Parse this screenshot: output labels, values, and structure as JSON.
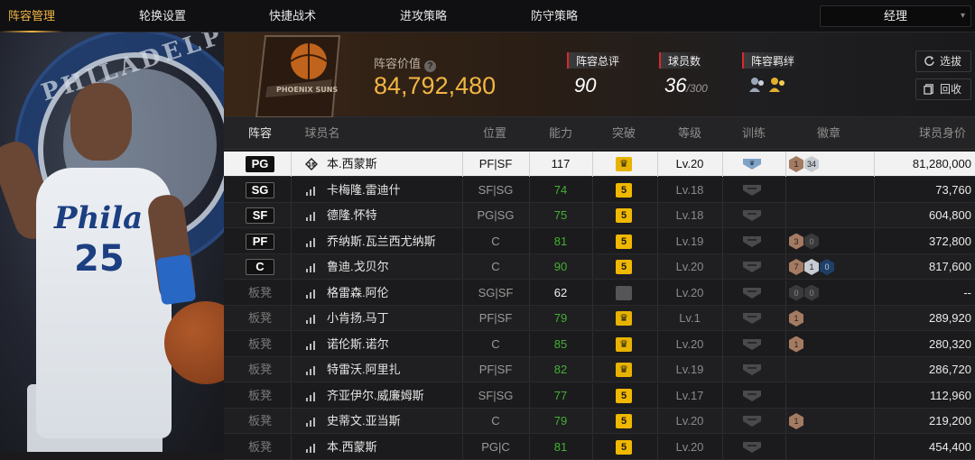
{
  "nav": {
    "tabs": [
      {
        "label": "阵容管理",
        "active": true
      },
      {
        "label": "轮换设置",
        "active": false
      },
      {
        "label": "快捷战术",
        "active": false
      },
      {
        "label": "进攻策略",
        "active": false
      },
      {
        "label": "防守策略",
        "active": false
      }
    ],
    "role_select": "经理"
  },
  "player_art": {
    "team_wordmark": "PHILADELPHIA",
    "jersey_text": "Phila",
    "jersey_number": "25"
  },
  "header": {
    "team_logo_text": "PHOENIX SUNS",
    "value_label": "阵容价值",
    "value": "84,792,480",
    "stats": [
      {
        "label": "阵容总评",
        "value": "90",
        "sub": ""
      },
      {
        "label": "球员数",
        "value": "36",
        "sub": "/300"
      },
      {
        "label": "阵容羁绊",
        "value": "",
        "sub": ""
      }
    ],
    "buttons": {
      "select": "选拔",
      "recall": "回收"
    }
  },
  "table": {
    "columns": [
      "阵容",
      "球员名",
      "位置",
      "能力",
      "突破",
      "等级",
      "训练",
      "徽章",
      "球员身价"
    ],
    "rows": [
      {
        "slot": "PG",
        "starter": true,
        "selected": true,
        "name": "本.西蒙斯",
        "pos": "PF|SF",
        "rating": "117",
        "rating_color": "white",
        "break": "crown",
        "level": "Lv.20",
        "train": "active",
        "badges": [
          {
            "t": "bronze",
            "n": "1"
          },
          {
            "t": "silver",
            "n": "34"
          }
        ],
        "value": "81,280,000"
      },
      {
        "slot": "SG",
        "starter": true,
        "selected": false,
        "name": "卡梅隆.雷迪什",
        "pos": "SF|SG",
        "rating": "74",
        "rating_color": "green",
        "break": "5",
        "level": "Lv.18",
        "train": "idle",
        "badges": [],
        "value": "73,760"
      },
      {
        "slot": "SF",
        "starter": true,
        "selected": false,
        "name": "德隆.怀特",
        "pos": "PG|SG",
        "rating": "75",
        "rating_color": "green",
        "break": "5",
        "level": "Lv.18",
        "train": "idle",
        "badges": [],
        "value": "604,800"
      },
      {
        "slot": "PF",
        "starter": true,
        "selected": false,
        "name": "乔纳斯.瓦兰西尤纳斯",
        "pos": "C",
        "rating": "81",
        "rating_color": "green",
        "break": "5",
        "level": "Lv.19",
        "train": "idle",
        "badges": [
          {
            "t": "bronze",
            "n": "3"
          },
          {
            "t": "dark",
            "n": "0"
          }
        ],
        "value": "372,800"
      },
      {
        "slot": "C",
        "starter": true,
        "selected": false,
        "name": "鲁迪.戈贝尔",
        "pos": "C",
        "rating": "90",
        "rating_color": "green",
        "break": "5",
        "level": "Lv.20",
        "train": "idle",
        "badges": [
          {
            "t": "bronze",
            "n": "7"
          },
          {
            "t": "silver",
            "n": "1"
          },
          {
            "t": "blue",
            "n": "0"
          }
        ],
        "value": "817,600"
      },
      {
        "slot": "板凳",
        "starter": false,
        "selected": false,
        "name": "格雷森.阿伦",
        "pos": "SG|SF",
        "rating": "62",
        "rating_color": "white",
        "break": "gray",
        "level": "Lv.20",
        "train": "idle",
        "badges": [
          {
            "t": "dark",
            "n": "0"
          },
          {
            "t": "dark",
            "n": "0"
          }
        ],
        "value": "--"
      },
      {
        "slot": "板凳",
        "starter": false,
        "selected": false,
        "name": "小肯扬.马丁",
        "pos": "PF|SF",
        "rating": "79",
        "rating_color": "green",
        "break": "crown",
        "level": "Lv.1",
        "train": "idle",
        "badges": [
          {
            "t": "bronze",
            "n": "1"
          }
        ],
        "value": "289,920"
      },
      {
        "slot": "板凳",
        "starter": false,
        "selected": false,
        "name": "诺伦斯.诺尔",
        "pos": "C",
        "rating": "85",
        "rating_color": "green",
        "break": "crown",
        "level": "Lv.20",
        "train": "idle",
        "badges": [
          {
            "t": "bronze",
            "n": "1"
          }
        ],
        "value": "280,320"
      },
      {
        "slot": "板凳",
        "starter": false,
        "selected": false,
        "name": "特雷沃.阿里扎",
        "pos": "PF|SF",
        "rating": "82",
        "rating_color": "green",
        "break": "crown",
        "level": "Lv.19",
        "train": "idle",
        "badges": [],
        "value": "286,720"
      },
      {
        "slot": "板凳",
        "starter": false,
        "selected": false,
        "name": "齐亚伊尔.威廉姆斯",
        "pos": "SF|SG",
        "rating": "77",
        "rating_color": "green",
        "break": "5",
        "level": "Lv.17",
        "train": "idle",
        "badges": [],
        "value": "112,960"
      },
      {
        "slot": "板凳",
        "starter": false,
        "selected": false,
        "name": "史蒂文.亚当斯",
        "pos": "C",
        "rating": "79",
        "rating_color": "green",
        "break": "5",
        "level": "Lv.20",
        "train": "idle",
        "badges": [
          {
            "t": "bronze",
            "n": "1"
          }
        ],
        "value": "219,200"
      },
      {
        "slot": "板凳",
        "starter": false,
        "selected": false,
        "name": "本.西蒙斯",
        "pos": "PG|C",
        "rating": "81",
        "rating_color": "green",
        "break": "5",
        "level": "Lv.20",
        "train": "idle",
        "badges": [],
        "value": "454,400"
      }
    ]
  },
  "colors": {
    "accent": "#f2b544",
    "rating_green": "#43b033",
    "red_marker": "#d92a2a"
  }
}
